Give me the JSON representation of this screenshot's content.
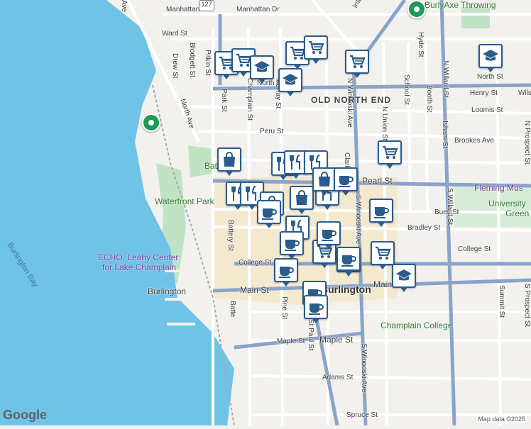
{
  "map": {
    "water_labels": [
      "Burlington Bay"
    ],
    "district_labels": [
      "OLD NORTH END"
    ],
    "city_label": "Burlington",
    "park_labels": [
      "Waterfront Park",
      "Battery"
    ],
    "poi_labels": [
      {
        "text": "ECHO, Leahy Center",
        "type": "purple"
      },
      {
        "text": "for Lake Champlain",
        "type": "purple"
      },
      {
        "text": "BurlyAxe Throwing",
        "type": "green"
      },
      {
        "text": "Fleming Mus",
        "type": "purple"
      },
      {
        "text": "University",
        "type": "green"
      },
      {
        "text": "Green",
        "type": "green"
      },
      {
        "text": "Champlain College",
        "type": "green"
      },
      {
        "text": "Burlington",
        "type": "plain"
      }
    ],
    "street_labels_h": [
      "Manhattan Dr",
      "Manhattan Dr",
      "Ward St",
      "North St",
      "North St",
      "Henry St",
      "Wils",
      "Loomis St",
      "Peru St",
      "Brookes Ave",
      "Pearl St",
      "Buell St",
      "Bradley St",
      "College St",
      "College St",
      "Main St",
      "Main St",
      "Maple St",
      "Maple St",
      "Adams St",
      "Spruce St"
    ],
    "street_labels_v": [
      "Pitkin St",
      "Blodgett St",
      "Drew St",
      "Park St",
      "Champlain St",
      "Murray St",
      "Intervale Ave",
      "School St",
      "Booth St",
      "Isham St",
      "N Willard St",
      "N Prospect St",
      "N Union St",
      "S Winooski Ave",
      "S Willard St",
      "Summit St",
      "S Prospect St",
      "Battery St",
      "Pine St",
      "St Paul St",
      "Clarke St",
      "North Ave",
      "N Winooski Ave",
      "Hyde St",
      "S Winooski Ave",
      "Batte",
      "Ave"
    ],
    "route_shield": "127",
    "markers": [
      {
        "icon": "cart"
      },
      {
        "icon": "cart"
      },
      {
        "icon": "cart"
      },
      {
        "icon": "cart"
      },
      {
        "icon": "cart"
      },
      {
        "icon": "cart"
      },
      {
        "icon": "cart"
      },
      {
        "icon": "cart"
      },
      {
        "icon": "cart"
      },
      {
        "icon": "school"
      },
      {
        "icon": "school"
      },
      {
        "icon": "school"
      },
      {
        "icon": "school"
      },
      {
        "icon": "restaurant"
      },
      {
        "icon": "restaurant"
      },
      {
        "icon": "restaurant"
      },
      {
        "icon": "restaurant"
      },
      {
        "icon": "restaurant"
      },
      {
        "icon": "restaurant"
      },
      {
        "icon": "restaurant"
      },
      {
        "icon": "bag"
      },
      {
        "icon": "bag"
      },
      {
        "icon": "bag"
      },
      {
        "icon": "bag"
      },
      {
        "icon": "cup"
      },
      {
        "icon": "cup"
      },
      {
        "icon": "cup"
      },
      {
        "icon": "cup"
      },
      {
        "icon": "cup"
      },
      {
        "icon": "cup"
      },
      {
        "icon": "cup"
      },
      {
        "icon": "cup"
      },
      {
        "icon": "cup"
      }
    ]
  },
  "footer": {
    "logo_text": "Google",
    "attribution": "Map data ©2025"
  },
  "colors": {
    "water": "#6fc3e6",
    "land": "#f3f1ee",
    "park": "#bfe3c3",
    "road_major": "#8aa3c9",
    "downtown": "#f2e3c2",
    "marker_border": "#2a5c8c"
  }
}
